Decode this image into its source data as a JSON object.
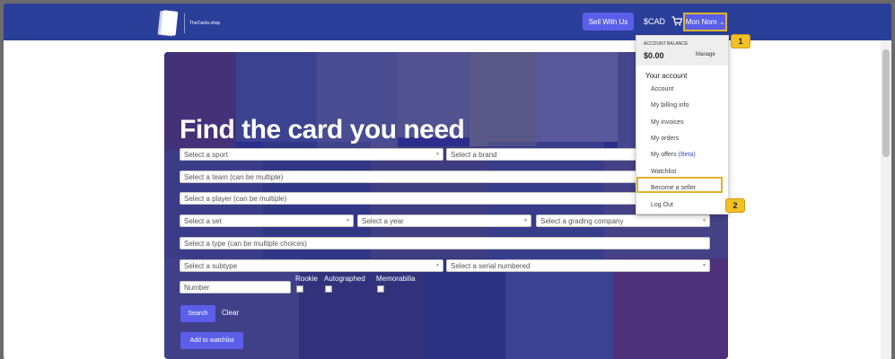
{
  "navbar": {
    "logo_text": "TheCards.shop",
    "sell_button": "Sell With Us",
    "currency": "$CAD",
    "user_button": "Mon Nom"
  },
  "hero": {
    "title": "Find the card you need"
  },
  "filters": {
    "sport_placeholder": "Select a sport",
    "brand_placeholder": "Select a brand",
    "team_placeholder": "Select a team (can be multiple)",
    "player_placeholder": "Select a player (can be multiple)",
    "set_placeholder": "Select a set",
    "year_placeholder": "Select a year",
    "grading_placeholder": "Select a grading company",
    "type_placeholder": "Select a type (can be multiple choices)",
    "subtype_placeholder": "Select a subtype",
    "serial_placeholder": "Select a serial numbered",
    "number_placeholder": "Number",
    "rookie_label": "Rookie",
    "autographed_label": "Autographed",
    "memorabilia_label": "Memorabilia",
    "search_button": "Search",
    "clear_button": "Clear",
    "watchlist_button": "Add to watchlist"
  },
  "dropdown": {
    "balance_label": "ACCOUNT BALANCE",
    "balance_value": "$0.00",
    "manage_label": "Manage",
    "section_title": "Your account",
    "items": [
      {
        "label": "Account"
      },
      {
        "label": "My billing info"
      },
      {
        "label": "My invoices"
      },
      {
        "label": "My orders"
      },
      {
        "label": "My offers",
        "suffix": "(Beta)"
      },
      {
        "label": "Watchlist"
      },
      {
        "label": "Become a seller"
      },
      {
        "label": "Log Out"
      }
    ]
  },
  "steps": [
    "1",
    "2"
  ],
  "colors": {
    "navbar": "#2a3f9a",
    "button": "#5b5ee8",
    "highlight": "#e2b22c",
    "step_badge": "#f3c026"
  }
}
